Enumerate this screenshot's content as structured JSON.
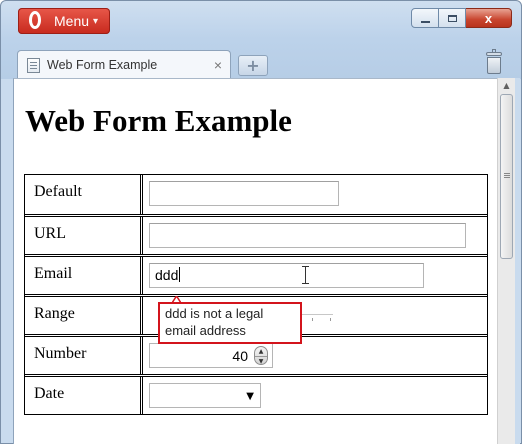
{
  "browser": {
    "menu_label": "Menu",
    "tab_title": "Web Form Example",
    "close_glyph": "x",
    "new_tab_glyph": "+"
  },
  "page": {
    "title": "Web Form Example"
  },
  "form": {
    "rows": [
      {
        "label": "Default",
        "value": ""
      },
      {
        "label": "URL",
        "value": ""
      },
      {
        "label": "Email",
        "value": "ddd"
      },
      {
        "label": "Range"
      },
      {
        "label": "Number",
        "value": "40"
      },
      {
        "label": "Date",
        "value": ""
      }
    ]
  },
  "validation": {
    "message_line1": "ddd is not a legal",
    "message_line2": "email address",
    "border_color": "#d3141c"
  },
  "colors": {
    "menu_button": "#c7291d",
    "close_button": "#c8442d",
    "chrome": "#bcd2ea"
  }
}
